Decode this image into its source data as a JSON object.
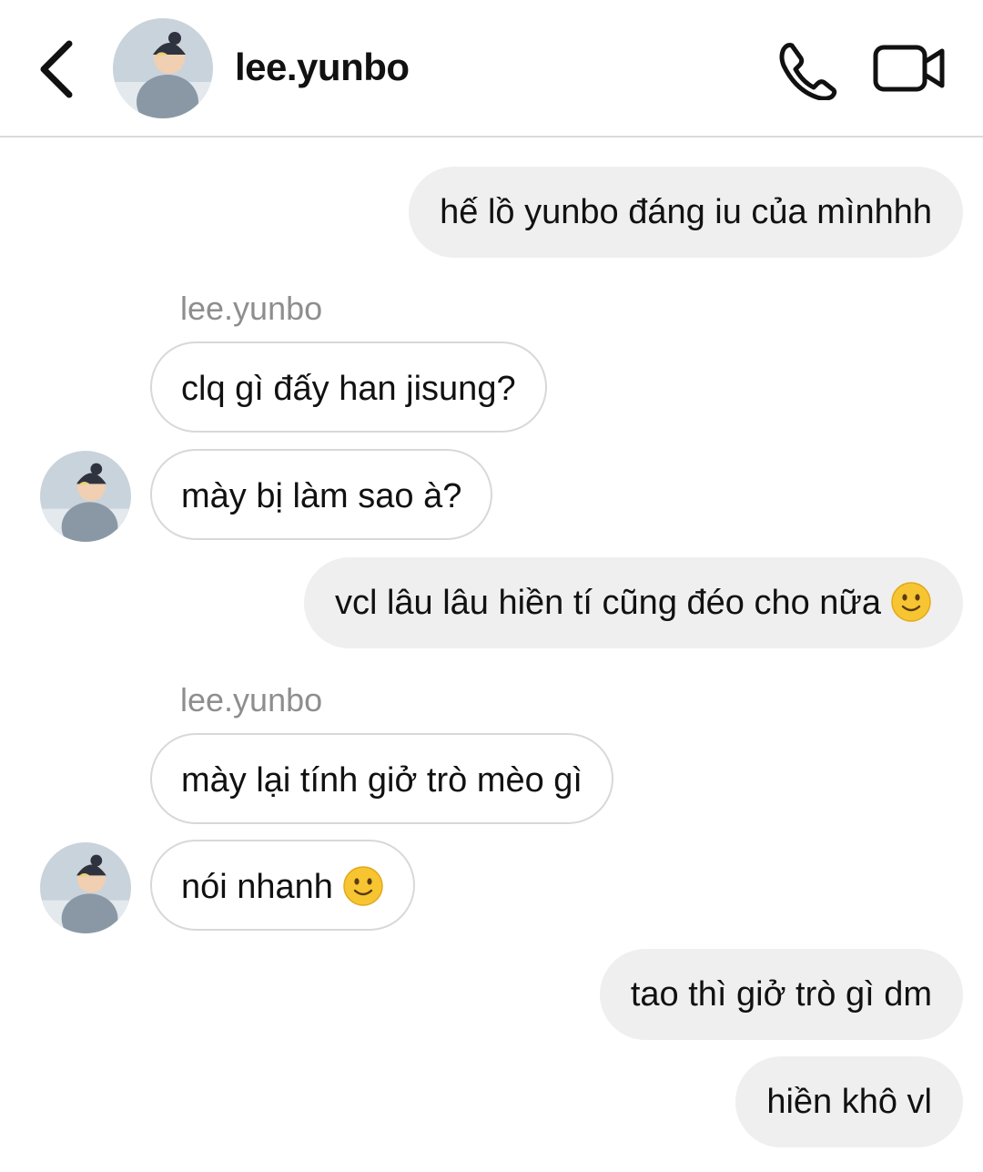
{
  "header": {
    "back_icon": "chevron-left-icon",
    "username": "lee.yunbo",
    "call_icon": "phone-icon",
    "video_icon": "video-camera-icon"
  },
  "messages": [
    {
      "direction": "outgoing",
      "text": "hế lồ yunbo đáng iu của mìnhhh"
    },
    {
      "direction": "incoming",
      "sender": "lee.yunbo",
      "text": "clq gì đấy han jisung?"
    },
    {
      "direction": "incoming",
      "text": "mày bị làm sao à?"
    },
    {
      "direction": "outgoing",
      "text": "vcl lâu lâu hiền tí cũng đéo cho nữa",
      "emoji": "slightly-smiling-face"
    },
    {
      "direction": "incoming",
      "sender": "lee.yunbo",
      "text": "mày lại tính giở trò mèo gì"
    },
    {
      "direction": "incoming",
      "text": "nói nhanh",
      "emoji": "slightly-smiling-face"
    },
    {
      "direction": "outgoing",
      "text": "tao thì giở trò gì dm"
    },
    {
      "direction": "outgoing",
      "text": "hiền khô vl"
    }
  ],
  "colors": {
    "outgoing_bubble": "#efefef",
    "incoming_border": "#d8d8d8",
    "sender_label": "#8e8e8e",
    "emoji_face": "#f7c531"
  }
}
